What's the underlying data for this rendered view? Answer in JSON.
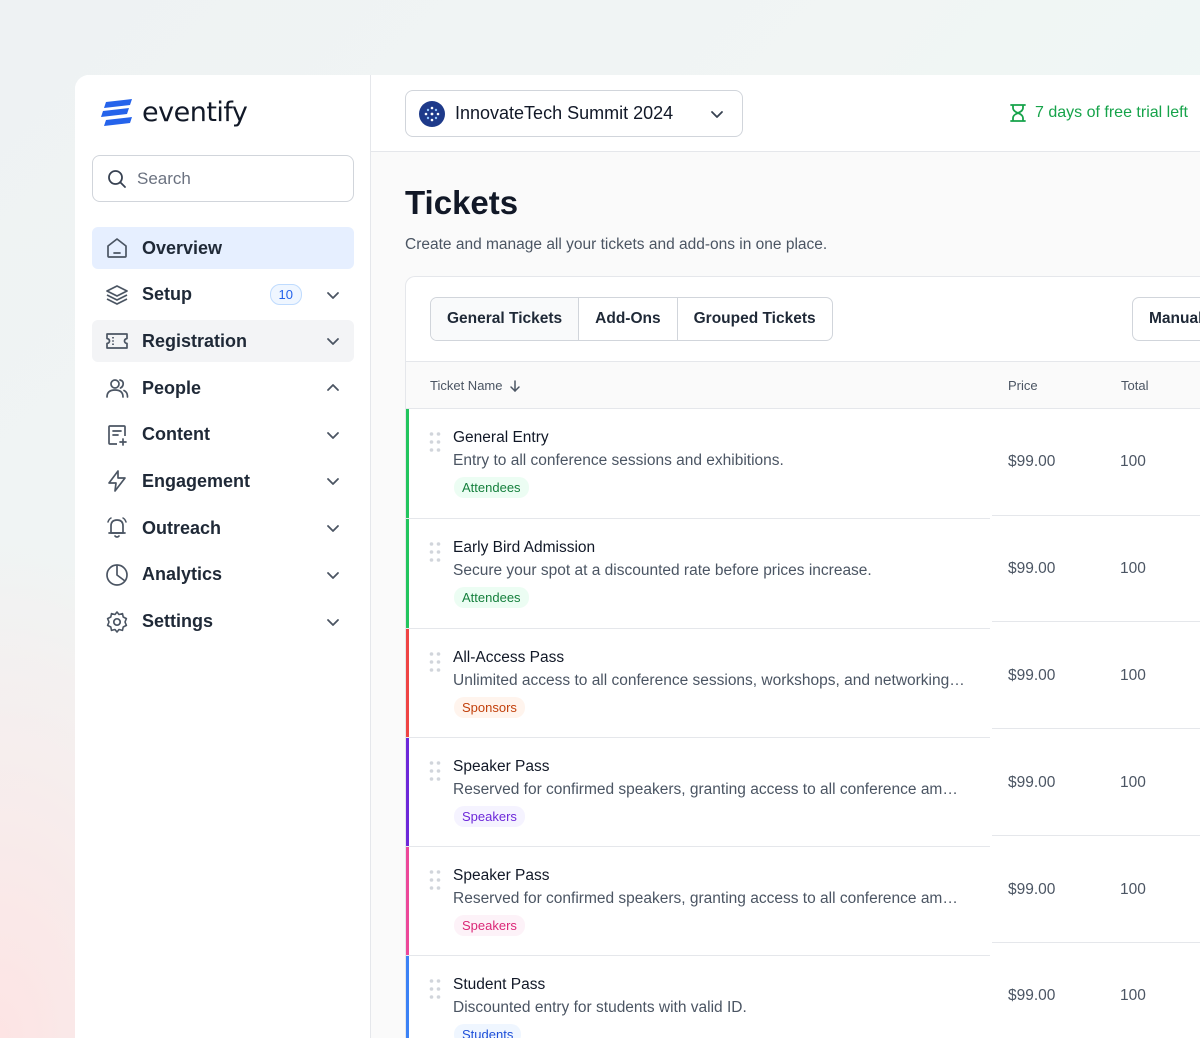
{
  "app": {
    "name": "eventify"
  },
  "sidebar": {
    "search_placeholder": "Search",
    "items": [
      {
        "label": "Overview",
        "icon": "home-icon"
      },
      {
        "label": "Setup",
        "icon": "layers-icon",
        "badge": "10"
      },
      {
        "label": "Registration",
        "icon": "ticket-icon"
      },
      {
        "label": "People",
        "icon": "users-icon"
      },
      {
        "label": "Content",
        "icon": "document-icon"
      },
      {
        "label": "Engagement",
        "icon": "lightning-icon"
      },
      {
        "label": "Outreach",
        "icon": "bell-icon"
      },
      {
        "label": "Analytics",
        "icon": "pie-chart-icon"
      },
      {
        "label": "Settings",
        "icon": "gear-icon"
      }
    ]
  },
  "topbar": {
    "event_name": "InnovateTech Summit 2024",
    "trial_text": "7 days of free trial left"
  },
  "page": {
    "title": "Tickets",
    "subtitle": "Create and manage all your tickets and add-ons in one place."
  },
  "tabs": [
    "General Tickets",
    "Add-Ons",
    "Grouped Tickets"
  ],
  "manual_button": "Manual",
  "table": {
    "headers": {
      "name": "Ticket Name",
      "price": "Price",
      "total": "Total"
    },
    "rows": [
      {
        "name": "General Entry",
        "desc": "Entry to all conference sessions and exhibitions.",
        "tag": "Attendees",
        "price": "$99.00",
        "total": "100",
        "color": "#22c55e",
        "tag_bg": "#ecfdf3",
        "tag_fg": "#15803d"
      },
      {
        "name": "Early Bird Admission",
        "desc": "Secure your spot at a discounted rate before prices increase.",
        "tag": "Attendees",
        "price": "$99.00",
        "total": "100",
        "color": "#22c55e",
        "tag_bg": "#ecfdf3",
        "tag_fg": "#15803d"
      },
      {
        "name": "All-Access Pass",
        "desc": "Unlimited access to all conference sessions, workshops, and networking events.",
        "tag": "Sponsors",
        "price": "$99.00",
        "total": "100",
        "color": "#ef4444",
        "tag_bg": "#fff4ed",
        "tag_fg": "#c2410c"
      },
      {
        "name": "Speaker Pass",
        "desc": "Reserved for confirmed speakers, granting access to all conference amenities.",
        "tag": "Speakers",
        "price": "$99.00",
        "total": "100",
        "color": "#6d28d9",
        "tag_bg": "#f5f3ff",
        "tag_fg": "#6d28d9"
      },
      {
        "name": "Speaker Pass",
        "desc": "Reserved for confirmed speakers, granting access to all conference amenities.",
        "tag": "Speakers",
        "price": "$99.00",
        "total": "100",
        "color": "#ec4899",
        "tag_bg": "#fdf2f8",
        "tag_fg": "#db2777"
      },
      {
        "name": "Student Pass",
        "desc": "Discounted entry for students with valid ID.",
        "tag": "Students",
        "price": "$99.00",
        "total": "100",
        "color": "#3b82f6",
        "tag_bg": "#eff6ff",
        "tag_fg": "#1d4ed8"
      }
    ]
  }
}
